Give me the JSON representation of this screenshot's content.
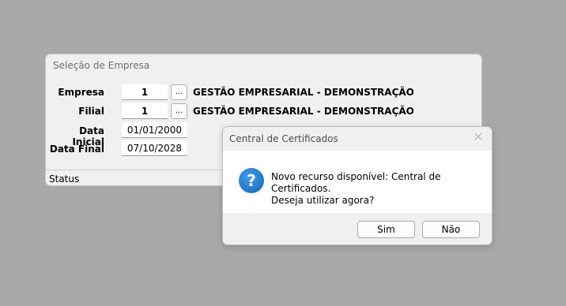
{
  "main_window": {
    "title": "Seleção de Empresa",
    "labels": {
      "empresa": "Empresa",
      "filial": "Filial",
      "data_inicial": "Data Inicial",
      "data_final": "Data Final"
    },
    "empresa": {
      "code": "1",
      "lookup": "...",
      "name": "GESTÃO EMPRESARIAL - DEMONSTRAÇÃO"
    },
    "filial": {
      "code": "1",
      "lookup": "...",
      "name": "GESTÃO EMPRESARIAL - DEMONSTRAÇÃO"
    },
    "data_inicial": "01/01/2000",
    "data_final": "07/10/2028",
    "status": "Status"
  },
  "dialog": {
    "title": "Central de Certificados",
    "close": "✕",
    "icon": "question-icon",
    "message_line1": "Novo recurso disponível: Central de Certificados.",
    "message_line2": "Deseja utilizar agora?",
    "yes": "Sim",
    "no": "Não"
  }
}
